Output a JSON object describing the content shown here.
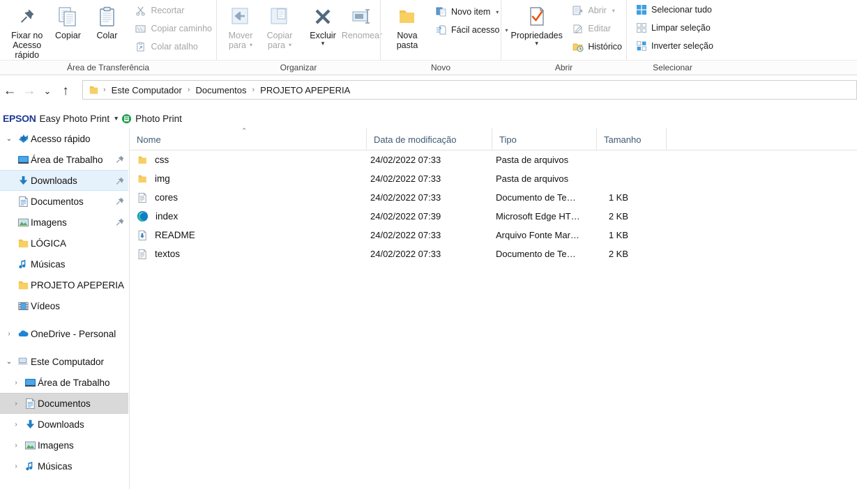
{
  "ribbon": {
    "groups": [
      {
        "label": "Área de Transferência",
        "big_buttons": [
          {
            "label_line1": "Fixar no",
            "label_line2": "Acesso rápido",
            "icon": "pin-icon",
            "enabled": true
          },
          {
            "label_line1": "Copiar",
            "label_line2": "",
            "icon": "copy-icon",
            "enabled": true
          },
          {
            "label_line1": "Colar",
            "label_line2": "",
            "icon": "paste-icon",
            "enabled": true
          }
        ],
        "small_buttons": [
          {
            "label": "Recortar",
            "icon": "scissors-icon",
            "enabled": false
          },
          {
            "label": "Copiar caminho",
            "icon": "copy-path-icon",
            "enabled": false
          },
          {
            "label": "Colar atalho",
            "icon": "paste-shortcut-icon",
            "enabled": false
          }
        ]
      },
      {
        "label": "Organizar",
        "big_buttons": [
          {
            "label_line1": "Mover",
            "label_line2": "para",
            "icon": "move-to-icon",
            "enabled": false,
            "dropdown": true
          },
          {
            "label_line1": "Copiar",
            "label_line2": "para",
            "icon": "copy-to-icon",
            "enabled": false,
            "dropdown": true
          },
          {
            "label_line1": "Excluir",
            "label_line2": "",
            "icon": "delete-x-icon",
            "enabled": true,
            "dropdown_below": true
          },
          {
            "label_line1": "Renomear",
            "label_line2": "",
            "icon": "rename-icon",
            "enabled": false
          }
        ],
        "small_buttons": []
      },
      {
        "label": "Novo",
        "big_buttons": [
          {
            "label_line1": "Nova",
            "label_line2": "pasta",
            "icon": "new-folder-icon",
            "enabled": true
          }
        ],
        "small_buttons": [
          {
            "label": "Novo item",
            "icon": "new-item-icon",
            "enabled": true,
            "dropdown": true
          },
          {
            "label": "Fácil acesso",
            "icon": "easy-access-icon",
            "enabled": true,
            "dropdown": true
          }
        ]
      },
      {
        "label": "Abrir",
        "big_buttons": [
          {
            "label_line1": "Propriedades",
            "label_line2": "",
            "icon": "properties-icon",
            "enabled": true,
            "dropdown_below": true
          }
        ],
        "small_buttons": [
          {
            "label": "Abrir",
            "icon": "open-icon",
            "enabled": false,
            "dropdown": true
          },
          {
            "label": "Editar",
            "icon": "edit-icon",
            "enabled": false
          },
          {
            "label": "Histórico",
            "icon": "history-icon",
            "enabled": true
          }
        ]
      },
      {
        "label": "Selecionar",
        "big_buttons": [],
        "small_buttons": [
          {
            "label": "Selecionar tudo",
            "icon": "select-all-icon",
            "enabled": true
          },
          {
            "label": "Limpar seleção",
            "icon": "select-none-icon",
            "enabled": true
          },
          {
            "label": "Inverter seleção",
            "icon": "invert-selection-icon",
            "enabled": true
          }
        ]
      }
    ]
  },
  "navbar": {
    "back_icon": "back-arrow-icon",
    "forward_icon": "forward-arrow-icon",
    "recent_icon": "chevron-down-icon",
    "up_icon": "up-arrow-icon",
    "breadcrumb": [
      "Este Computador",
      "Documentos",
      "PROJETO APEPERIA"
    ],
    "separator": "›"
  },
  "epson_bar": {
    "logo": "EPSON",
    "menu_label": "Easy Photo Print",
    "dropdown_icon": "chevron-down-icon",
    "button_icon": "epson-photo-print-icon",
    "button_label": "Photo Print"
  },
  "sidebar": {
    "sections": [
      {
        "name": "Acesso rápido",
        "icon": "quick-access-star-icon",
        "expanded": true,
        "items": [
          {
            "label": "Área de Trabalho",
            "icon": "desktop-icon",
            "pinned": true,
            "selected": false
          },
          {
            "label": "Downloads",
            "icon": "downloads-icon",
            "pinned": true,
            "selected": true
          },
          {
            "label": "Documentos",
            "icon": "documents-icon",
            "pinned": true,
            "selected": false
          },
          {
            "label": "Imagens",
            "icon": "pictures-icon",
            "pinned": true,
            "selected": false
          },
          {
            "label": "LÓGICA",
            "icon": "folder-icon",
            "pinned": false,
            "selected": false
          },
          {
            "label": "Músicas",
            "icon": "music-icon",
            "pinned": false,
            "selected": false
          },
          {
            "label": "PROJETO APEPERIA",
            "icon": "folder-icon",
            "pinned": false,
            "selected": false
          },
          {
            "label": "Vídeos",
            "icon": "videos-icon",
            "pinned": false,
            "selected": false
          }
        ]
      },
      {
        "name": "OneDrive - Personal",
        "icon": "onedrive-icon",
        "expanded": false,
        "items": []
      },
      {
        "name": "Este Computador",
        "icon": "this-pc-icon",
        "expanded": true,
        "items": [
          {
            "label": "Área de Trabalho",
            "icon": "desktop-icon",
            "pinned": false,
            "selected": false,
            "expandable": true
          },
          {
            "label": "Documentos",
            "icon": "documents-icon",
            "pinned": false,
            "selected": true,
            "expandable": true
          },
          {
            "label": "Downloads",
            "icon": "downloads-icon",
            "pinned": false,
            "selected": false,
            "expandable": true
          },
          {
            "label": "Imagens",
            "icon": "pictures-icon",
            "pinned": false,
            "selected": false,
            "expandable": true
          },
          {
            "label": "Músicas",
            "icon": "music-icon",
            "pinned": false,
            "selected": false,
            "expandable": true
          }
        ]
      }
    ]
  },
  "filelist": {
    "columns": [
      {
        "label": "Nome",
        "sorted": true,
        "sort_direction": "asc"
      },
      {
        "label": "Data de modificação",
        "sorted": false
      },
      {
        "label": "Tipo",
        "sorted": false
      },
      {
        "label": "Tamanho",
        "sorted": false
      }
    ],
    "rows": [
      {
        "name": "css",
        "icon": "folder-icon",
        "date": "24/02/2022 07:33",
        "type": "Pasta de arquivos",
        "size": ""
      },
      {
        "name": "img",
        "icon": "folder-icon",
        "date": "24/02/2022 07:33",
        "type": "Pasta de arquivos",
        "size": ""
      },
      {
        "name": "cores",
        "icon": "text-file-icon",
        "date": "24/02/2022 07:33",
        "type": "Documento de Te…",
        "size": "1 KB"
      },
      {
        "name": "index",
        "icon": "edge-icon",
        "date": "24/02/2022 07:39",
        "type": "Microsoft Edge HT…",
        "size": "2 KB"
      },
      {
        "name": "README",
        "icon": "markdown-icon",
        "date": "24/02/2022 07:33",
        "type": "Arquivo Fonte Mar…",
        "size": "1 KB"
      },
      {
        "name": "textos",
        "icon": "text-file-icon",
        "date": "24/02/2022 07:33",
        "type": "Documento de Te…",
        "size": "2 KB"
      }
    ]
  },
  "colors": {
    "selection_blue": "#e5f1fb",
    "selection_gray": "#d9d9d9",
    "header_text": "#3f5a73",
    "folder_yellow": "#f7cf63",
    "epson_blue": "#1f3a93",
    "accent_blue": "#0a70c8"
  }
}
